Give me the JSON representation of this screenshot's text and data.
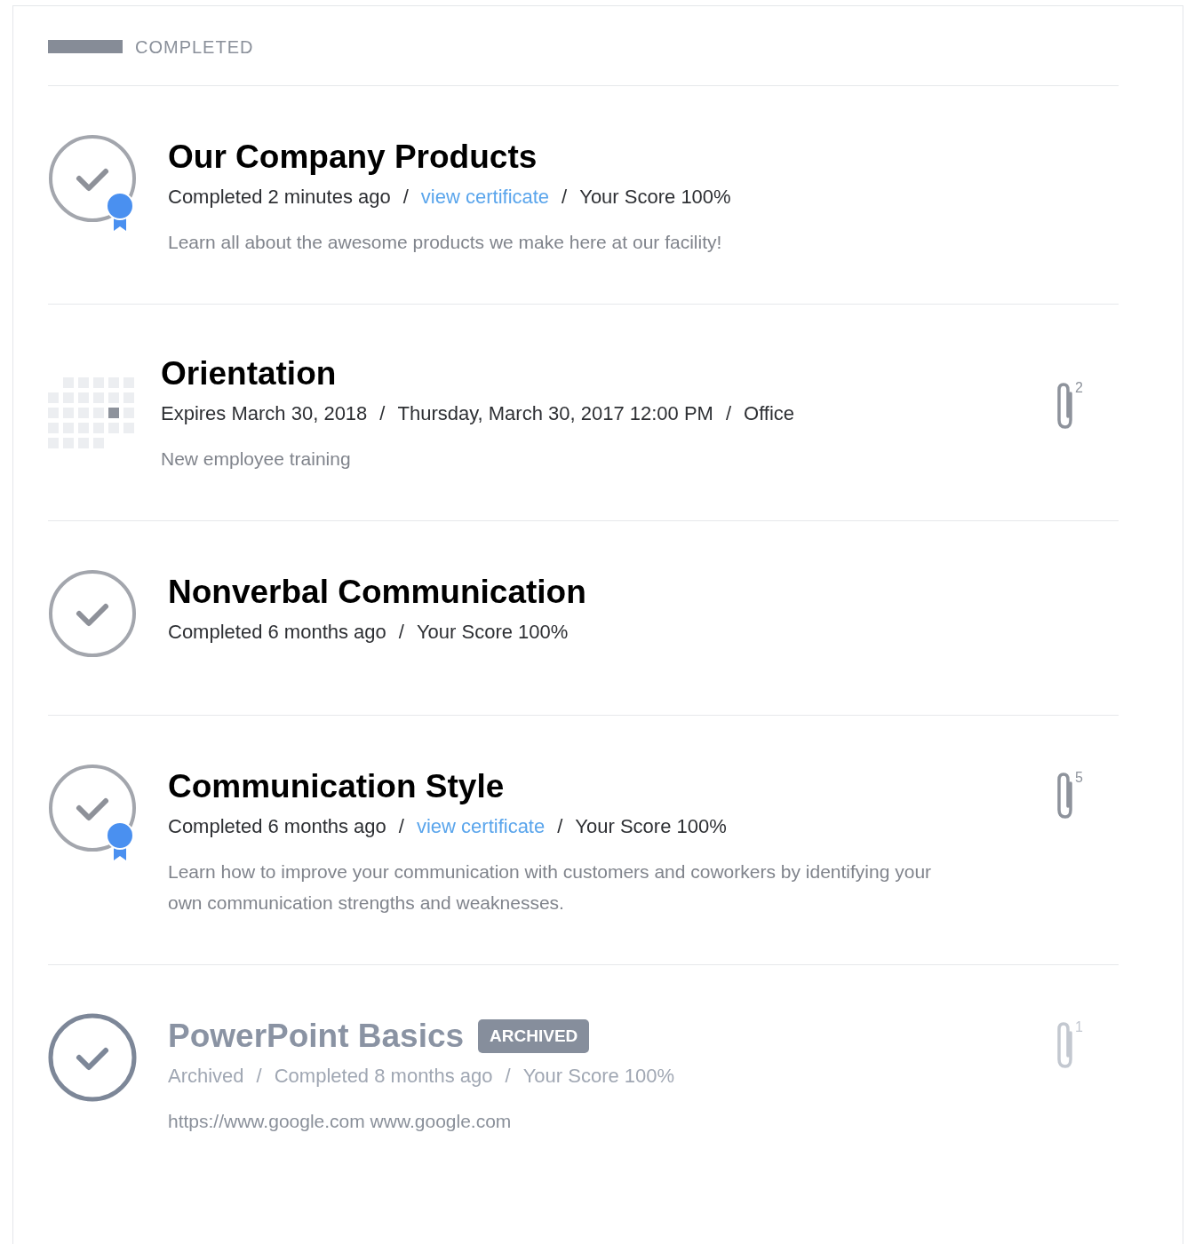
{
  "section": {
    "title": "COMPLETED"
  },
  "separator": "/",
  "items": [
    {
      "kind": "course",
      "title": "Our Company Products",
      "certificate": true,
      "archived": false,
      "meta": [
        {
          "kind": "text",
          "text": "Completed 2 minutes ago"
        },
        {
          "kind": "link",
          "text": "view certificate"
        },
        {
          "kind": "text",
          "text": "Your Score 100%"
        }
      ],
      "description": "Learn all about the awesome products we make here at our facility!"
    },
    {
      "kind": "event",
      "title": "Orientation",
      "meta": [
        {
          "kind": "text",
          "text": "Expires March 30, 2018"
        },
        {
          "kind": "text",
          "text": "Thursday, March 30, 2017 12:00 PM"
        },
        {
          "kind": "text",
          "text": "Office"
        }
      ],
      "description": "New employee training",
      "attachments": "2"
    },
    {
      "kind": "course",
      "title": "Nonverbal Communication",
      "certificate": false,
      "archived": false,
      "meta": [
        {
          "kind": "text",
          "text": "Completed 6 months ago"
        },
        {
          "kind": "text",
          "text": "Your Score 100%"
        }
      ]
    },
    {
      "kind": "course",
      "title": "Communication Style",
      "certificate": true,
      "archived": false,
      "meta": [
        {
          "kind": "text",
          "text": "Completed 6 months ago"
        },
        {
          "kind": "link",
          "text": "view certificate"
        },
        {
          "kind": "text",
          "text": "Your Score 100%"
        }
      ],
      "description": "Learn how to improve your communication with customers and coworkers by identifying your own communication strengths and weaknesses.",
      "attachments": "5"
    },
    {
      "kind": "course",
      "title": "PowerPoint Basics",
      "badge": "ARCHIVED",
      "certificate": false,
      "archived": true,
      "meta": [
        {
          "kind": "text",
          "text": "Archived"
        },
        {
          "kind": "text",
          "text": "Completed 8 months ago"
        },
        {
          "kind": "text",
          "text": "Your Score 100%"
        }
      ],
      "description": "https://www.google.com www.google.com",
      "attachments": "1"
    }
  ]
}
